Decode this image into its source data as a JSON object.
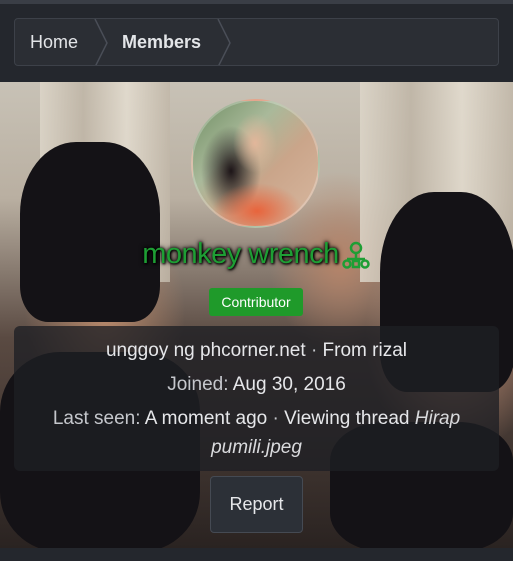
{
  "breadcrumb": {
    "items": [
      "Home",
      "Members"
    ]
  },
  "profile": {
    "username": "monkey wrench",
    "username_icon": "user-network-icon",
    "badge": "Contributor",
    "colors": {
      "username": "#1e9e34",
      "badge_bg": "#1f9a2a"
    }
  },
  "info": {
    "tagline": "unggoy ng phcorner.net",
    "sep": "·",
    "from_label": "From",
    "from_value": "rizal",
    "joined_label": "Joined:",
    "joined_value": "Aug 30, 2016",
    "last_seen_label": "Last seen:",
    "last_seen_value": "A moment ago",
    "activity_label": "Viewing thread",
    "thread_title_part1": "Hirap",
    "thread_title_part2": "pumili.jpeg"
  },
  "actions": {
    "report_label": "Report"
  }
}
